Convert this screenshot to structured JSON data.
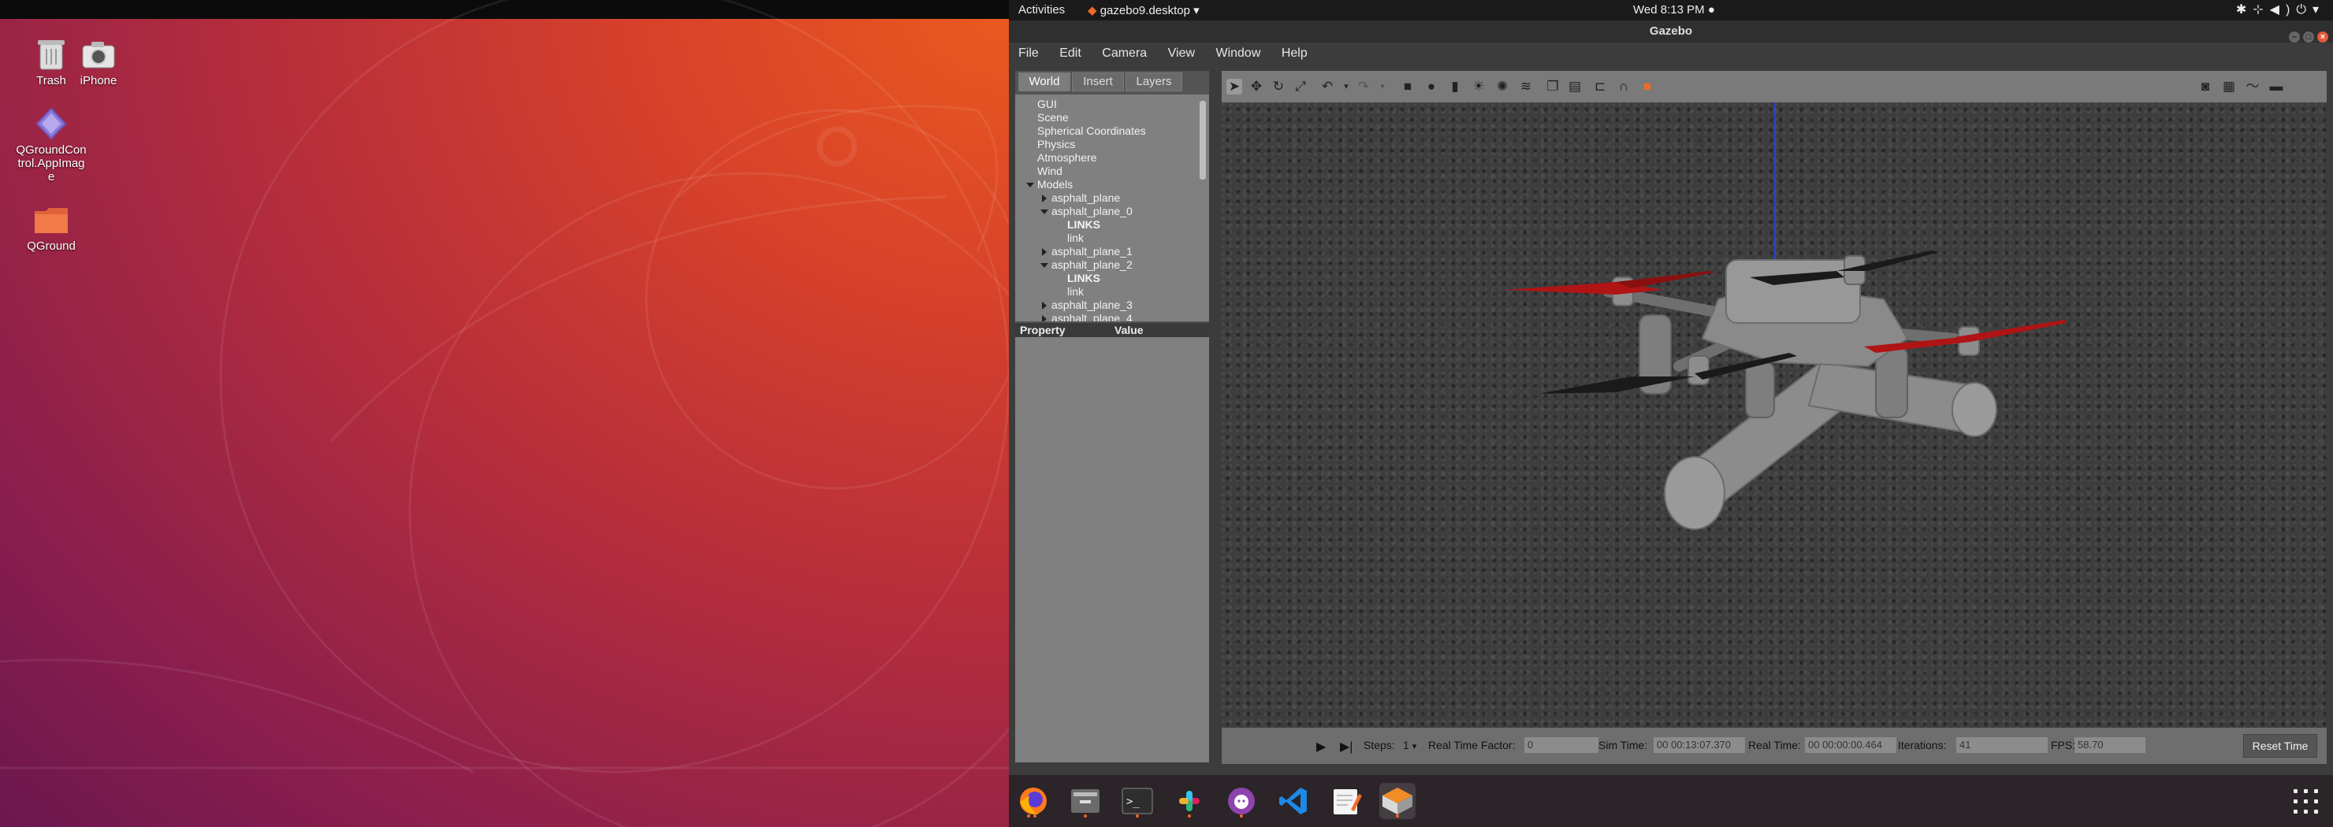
{
  "desktop": {
    "icons": [
      {
        "label": "Trash",
        "icon": "trash-icon"
      },
      {
        "label": "iPhone",
        "icon": "camera-icon"
      },
      {
        "label": "QGroundControl.AppImage",
        "icon": "diamond-icon"
      },
      {
        "label": "QGround",
        "icon": "folder-icon"
      }
    ]
  },
  "topbar": {
    "activities": "Activities",
    "app_menu": "gazebo9.desktop",
    "clock": "Wed  8:13 PM"
  },
  "window": {
    "title": "Gazebo",
    "menu": [
      "File",
      "Edit",
      "Camera",
      "View",
      "Window",
      "Help"
    ]
  },
  "left_panel": {
    "tabs": [
      "World",
      "Insert",
      "Layers"
    ],
    "tree": [
      {
        "label": "GUI",
        "indent": 0,
        "arrow": "none",
        "bold": false
      },
      {
        "label": "Scene",
        "indent": 0,
        "arrow": "none",
        "bold": false
      },
      {
        "label": "Spherical Coordinates",
        "indent": 0,
        "arrow": "none",
        "bold": false
      },
      {
        "label": "Physics",
        "indent": 0,
        "arrow": "none",
        "bold": false
      },
      {
        "label": "Atmosphere",
        "indent": 0,
        "arrow": "none",
        "bold": false
      },
      {
        "label": "Wind",
        "indent": 0,
        "arrow": "none",
        "bold": false
      },
      {
        "label": "Models",
        "indent": 0,
        "arrow": "down",
        "bold": false
      },
      {
        "label": "asphalt_plane",
        "indent": 1,
        "arrow": "right",
        "bold": false
      },
      {
        "label": "asphalt_plane_0",
        "indent": 1,
        "arrow": "down",
        "bold": false
      },
      {
        "label": "LINKS",
        "indent": 2,
        "arrow": "none",
        "bold": true
      },
      {
        "label": "link",
        "indent": 2,
        "arrow": "none",
        "bold": false
      },
      {
        "label": "asphalt_plane_1",
        "indent": 1,
        "arrow": "right",
        "bold": false
      },
      {
        "label": "asphalt_plane_2",
        "indent": 1,
        "arrow": "down",
        "bold": false
      },
      {
        "label": "LINKS",
        "indent": 2,
        "arrow": "none",
        "bold": true
      },
      {
        "label": "link",
        "indent": 2,
        "arrow": "none",
        "bold": false
      },
      {
        "label": "asphalt_plane_3",
        "indent": 1,
        "arrow": "right",
        "bold": false
      },
      {
        "label": "asphalt_plane_4",
        "indent": 1,
        "arrow": "right",
        "bold": false
      }
    ],
    "property_header": {
      "property": "Property",
      "value": "Value"
    }
  },
  "bottom_bar": {
    "steps_label": "Steps:",
    "steps_value": "1",
    "rtf_label": "Real Time Factor:",
    "rtf_value": "0",
    "sim_time_label": "Sim Time:",
    "sim_time_value": "00 00:13:07.370",
    "real_time_label": "Real Time:",
    "real_time_value": "00 00:00:00.464",
    "iterations_label": "Iterations:",
    "iterations_value": "41",
    "fps_label": "FPS:",
    "fps_value": "58.70",
    "reset_label": "Reset Time"
  },
  "dock": {
    "apps": [
      "firefox-icon",
      "files-icon",
      "terminal-icon",
      "slack-icon",
      "github-icon",
      "vscode-icon",
      "text-editor-icon",
      "gazebo-icon"
    ]
  },
  "colors": {
    "propeller_red": "#b01414",
    "propeller_black": "#1a1a1a",
    "drone_gray": "#8a8a8a",
    "accent_orange": "#ef6a2a"
  }
}
